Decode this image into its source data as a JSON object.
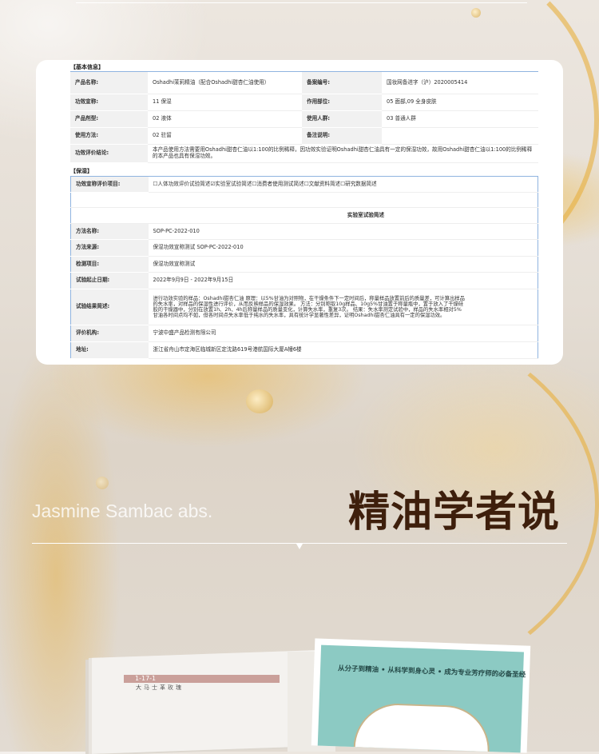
{
  "basic": {
    "section": "【基本信息】",
    "rows": [
      {
        "l1": "产品名称:",
        "v1": "Oshadhi茉莉精油（配合Oshadhi甜杏仁油使用）",
        "l2": "备案编号:",
        "v2": "国妆网备进字（沪）2020005414"
      },
      {
        "l1": "功效宣称:",
        "v1": "11 保湿",
        "l2": "作用部位:",
        "v2": "05 面部,09 全身皮肤"
      },
      {
        "l1": "产品剂型:",
        "v1": "02 液体",
        "l2": "使用人群:",
        "v2": "03 普通人群"
      },
      {
        "l1": "使用方法:",
        "v1": "02 驻留",
        "l2": "备注说明:",
        "v2": ""
      }
    ],
    "conclusion_label": "功效评价结论:",
    "conclusion": "本产品使用方法需要用Oshadhi甜杏仁油以1:100的比例稀释，因功效实验证明Oshadhi甜杏仁油具有一定的保湿功效，故用Oshadhi甜杏仁油以1:100的比例稀释的本产品也具有保湿功效。"
  },
  "moist": {
    "section": "【保湿】",
    "items_label": "功效宣称评价项目:",
    "checks": [
      {
        "label": "人体功效评价试验简述",
        "checked": false
      },
      {
        "label": "实验室试验简述",
        "checked": true
      },
      {
        "label": "消费者使用测试简述",
        "checked": false
      },
      {
        "label": "文献资料简述",
        "checked": false
      },
      {
        "label": "研究数据简述",
        "checked": false
      }
    ],
    "lab_heading": "实验室试验简述",
    "rows": [
      {
        "l": "方法名称:",
        "v": "SOP-PC-2022-010"
      },
      {
        "l": "方法来源:",
        "v": "保湿功效宣称测试 SOP-PC-2022-010"
      },
      {
        "l": "检测项目:",
        "v": "保湿功效宣称测试"
      },
      {
        "l": "试验起止日期:",
        "v": "2022年9月9日 - 2022年9月15日"
      },
      {
        "l": "试验结果简述:",
        "v": "进行功效实验的样品：Oshadhi甜杏仁油 原理：以5%甘油为对照物，在干燥条件下一定时间后，称量样品放置前后的质量差，可计算出样品的失水率，对样品的保湿性进行评价，从而反映样品的保湿效果。 方法：分别称取10g样品、10g5%甘油置于称量瓶中，置于放入了干燥硅胶的干燥器中，分别在放置1h、2h、4h后称量样品的质量变化，计算失水率，重复3次。 结果：失水率测定试验中，样品的失水率相对5%甘油各时间点均不如，但各时间点失水率低于纯水的失水率，具有统计学显著性差异，证明Oshadhi甜杏仁油具有一定的保湿功效。"
      },
      {
        "l": "评价机构:",
        "v": "宁波中盛产品检测有限公司"
      },
      {
        "l": "地址:",
        "v": "浙江省舟山市定海区临城新区定沈路619号港航国际大厦A幢6楼"
      }
    ]
  },
  "banner": {
    "subtitle": "Jasmine Sambac abs.",
    "title": "精油学者说"
  },
  "book": {
    "page_code": "1-17-1",
    "heading": "大马士革玫瑰",
    "cover_tagline": "从分子到精油 • 从科学到身心灵 • 成为专业芳疗师的必备圣经"
  }
}
